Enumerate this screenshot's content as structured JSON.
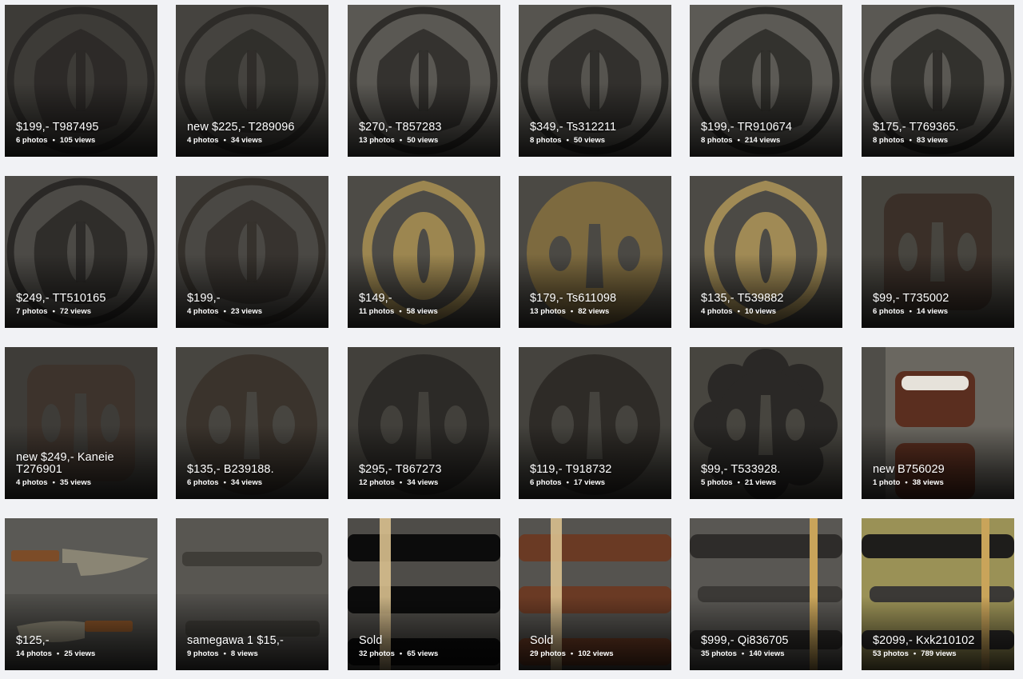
{
  "gallery": {
    "items": [
      {
        "title": "$199,- T987495",
        "photos": "6 photos",
        "views": "105 views",
        "kind": "tsuba-round",
        "bg": "#3d3b37",
        "metal": "#2a2826"
      },
      {
        "title": "new $225,- T289096",
        "photos": "4 photos",
        "views": "34 views",
        "kind": "tsuba-round",
        "bg": "#45433f",
        "metal": "#2d2b28"
      },
      {
        "title": "$270,- T857283",
        "photos": "13 photos",
        "views": "50 views",
        "kind": "tsuba-round",
        "bg": "#5a5853",
        "metal": "#2e2c29"
      },
      {
        "title": "$349,- Ts312211",
        "photos": "8 photos",
        "views": "50 views",
        "kind": "tsuba-round",
        "bg": "#56544f",
        "metal": "#2b2a27"
      },
      {
        "title": "$199,- TR910674",
        "photos": "8 photos",
        "views": "214 views",
        "kind": "tsuba-round",
        "bg": "#5c5a55",
        "metal": "#2c2b28"
      },
      {
        "title": "$175,- T769365.",
        "photos": "8 photos",
        "views": "83 views",
        "kind": "tsuba-round",
        "bg": "#5a5853",
        "metal": "#2b2a27"
      },
      {
        "title": "$249,- TT510165",
        "photos": "7 photos",
        "views": "72 views",
        "kind": "tsuba-round",
        "bg": "#4c4a46",
        "metal": "#2a2826"
      },
      {
        "title": "$199,-",
        "photos": "4 photos",
        "views": "23 views",
        "kind": "tsuba-round",
        "bg": "#4a4844",
        "metal": "#34302b"
      },
      {
        "title": "$149,-",
        "photos": "11 photos",
        "views": "58 views",
        "kind": "tsuba-brass",
        "bg": "#4d4b46",
        "metal": "#9c8650"
      },
      {
        "title": "$179,- Ts611098",
        "photos": "13 photos",
        "views": "82 views",
        "kind": "tsuba-brass-oval",
        "bg": "#4b4944",
        "metal": "#7d6a3f"
      },
      {
        "title": "$135,- T539882",
        "photos": "4 photos",
        "views": "10 views",
        "kind": "tsuba-brass",
        "bg": "#4c4a45",
        "metal": "#a08a55"
      },
      {
        "title": "$99,- T735002",
        "photos": "6 photos",
        "views": "14 views",
        "kind": "tsuba-square",
        "bg": "#47453f",
        "metal": "#3a2f28"
      },
      {
        "title": "new $249,- Kaneie T276901",
        "photos": "4 photos",
        "views": "35 views",
        "kind": "tsuba-square",
        "bg": "#3e3c38",
        "metal": "#3d332c"
      },
      {
        "title": "$135,- B239188.",
        "photos": "6 photos",
        "views": "34 views",
        "kind": "tsuba-oval",
        "bg": "#474540",
        "metal": "#3a332c"
      },
      {
        "title": "$295,- T867273",
        "photos": "12 photos",
        "views": "34 views",
        "kind": "tsuba-oval",
        "bg": "#42403b",
        "metal": "#2c2a27"
      },
      {
        "title": "$119,- T918732",
        "photos": "6 photos",
        "views": "17 views",
        "kind": "tsuba-oval",
        "bg": "#45433e",
        "metal": "#2e2b27"
      },
      {
        "title": "$99,- T533928.",
        "photos": "5 photos",
        "views": "21 views",
        "kind": "tsuba-flower",
        "bg": "#47453f",
        "metal": "#2a2826"
      },
      {
        "title": "new B756029",
        "photos": "1 photo",
        "views": "38 views",
        "kind": "koiguchi",
        "bg": "#4f4d48",
        "metal": "#5a2e1f"
      },
      {
        "title": "$125,-",
        "photos": "14 photos",
        "views": "25 views",
        "kind": "knives",
        "bg": "#5a5955",
        "metal": "#8a8574"
      },
      {
        "title": "samegawa 1 $15,-",
        "photos": "9 photos",
        "views": "8 views",
        "kind": "samegawa",
        "bg": "#585651",
        "metal": "#3f3d38"
      },
      {
        "title": "Sold",
        "photos": "32 photos",
        "views": "65 views",
        "kind": "saya-black",
        "bg": "#4e4c48",
        "metal": "#0c0c0c"
      },
      {
        "title": "Sold",
        "photos": "29 photos",
        "views": "102 views",
        "kind": "saya-brown",
        "bg": "#55534f",
        "metal": "#6a3a24"
      },
      {
        "title": "$999,- Qi836705",
        "photos": "35 photos",
        "views": "140 views",
        "kind": "katana",
        "bg": "#595753",
        "metal": "#2e2c2a"
      },
      {
        "title": "$2099,- Kxk210102",
        "photos": "53 photos",
        "views": "789 views",
        "kind": "katana-gold",
        "bg": "#9a9156",
        "metal": "#1e1d1b"
      }
    ]
  }
}
